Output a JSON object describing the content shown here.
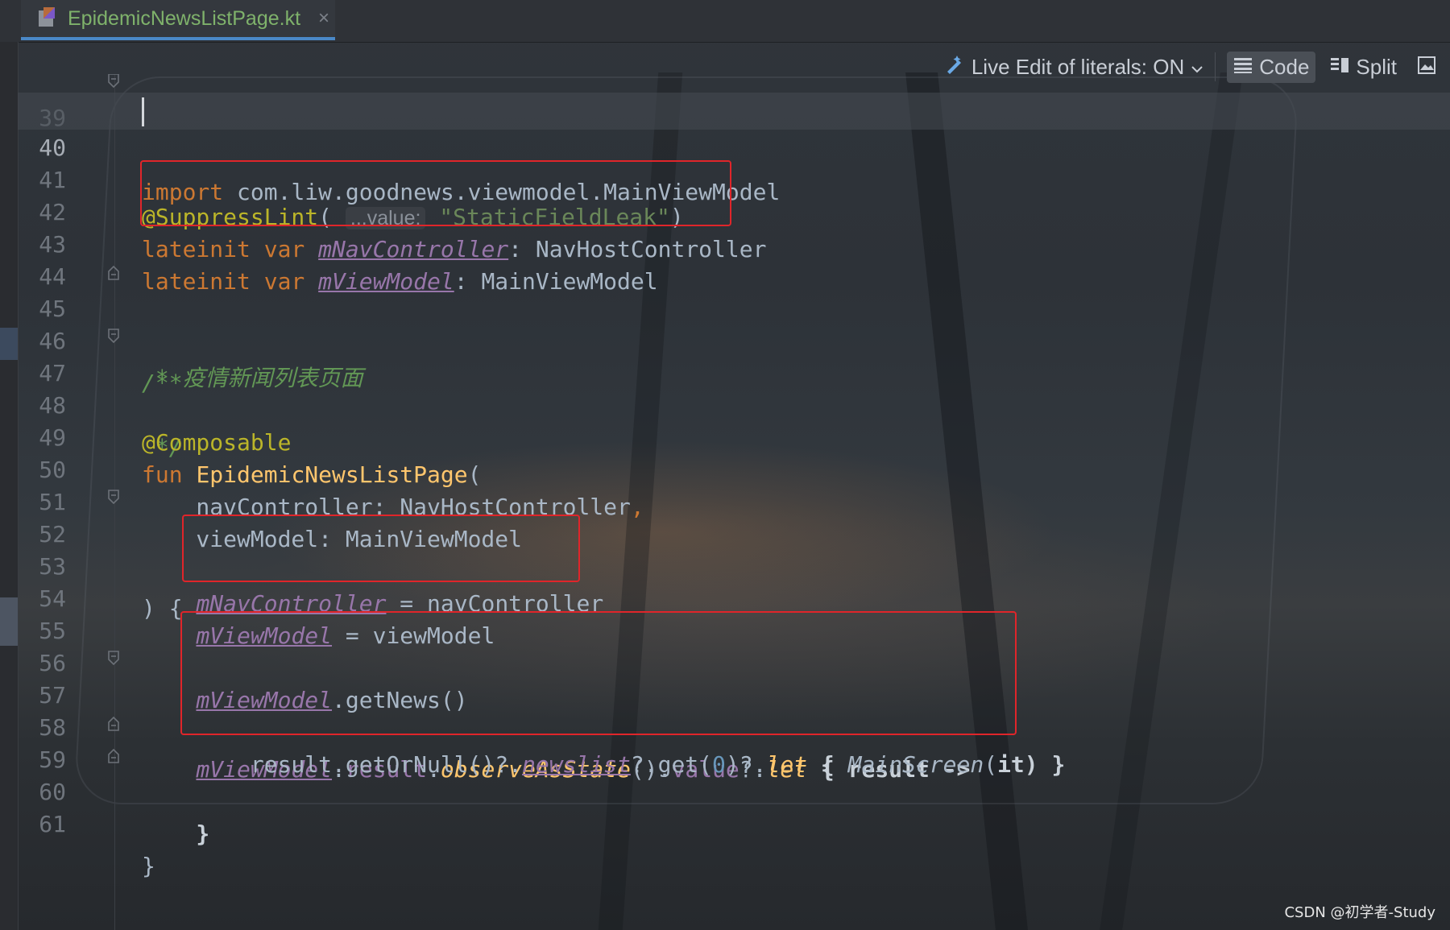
{
  "tab": {
    "filename": "EpidemicNewsListPage.kt",
    "close": "×"
  },
  "toolbar": {
    "live_edit": "Live Edit of literals: ON",
    "code": "Code",
    "split": "Split"
  },
  "code": {
    "l39": {
      "num": "39",
      "kw": "import",
      "rest": " com.liw.goodnews.viewmodel.MainViewModel"
    },
    "l40": {
      "num": "40"
    },
    "l41": {
      "num": "41",
      "ann": "@SuppressLint",
      "p1": "(",
      "hint": "...value:",
      "str": "\"StaticFieldLeak\"",
      "p2": ")"
    },
    "l42": {
      "num": "42",
      "kw": "lateinit var ",
      "prop": "mNavController",
      "rest": ": NavHostController"
    },
    "l43": {
      "num": "43",
      "kw": "lateinit var ",
      "prop": "mViewModel",
      "rest": ": MainViewModel"
    },
    "l44": {
      "num": "44"
    },
    "l45": {
      "num": "45",
      "cmt": "/**"
    },
    "l46": {
      "num": "46",
      "cmt": " * 疫情新闻列表页面"
    },
    "l47": {
      "num": "47",
      "cmt": " */"
    },
    "l48": {
      "num": "48",
      "ann": "@Composable"
    },
    "l49": {
      "num": "49",
      "kw": "fun ",
      "fn": "EpidemicNewsListPage",
      "rest": "("
    },
    "l50": {
      "num": "50",
      "text": "    navController: NavHostController",
      "comma": ","
    },
    "l51": {
      "num": "51",
      "text": "    viewModel: MainViewModel"
    },
    "l52": {
      "num": "52",
      "text": ") {"
    },
    "l53": {
      "num": "53",
      "indent": "    ",
      "prop": "mNavController",
      "rest": " = navController"
    },
    "l54": {
      "num": "54",
      "indent": "    ",
      "prop": "mViewModel",
      "rest": " = viewModel"
    },
    "l55": {
      "num": "55"
    },
    "l56": {
      "num": "56",
      "indent": "    ",
      "prop": "mViewModel",
      "rest": ".getNews()"
    },
    "l57": {
      "num": "57",
      "indent": "    ",
      "prop": "mViewModel",
      "a": ".",
      "b": "result",
      "c": ".",
      "d": "observeAsState",
      "e": "().",
      "f": "value",
      "g": "?.",
      "h": "let",
      "i": " { result ->"
    },
    "l58": {
      "num": "58",
      "indent": "        ",
      "a": "result.getOrNull()?.",
      "b": "newslist",
      "c": "?.get(",
      "d": "0",
      "e": ")?.",
      "f": "let",
      "g": " { ",
      "h": "MainScreen",
      "i": "(",
      "j": "it",
      "k": ") }"
    },
    "l59": {
      "num": "59",
      "text": "    }"
    },
    "l60": {
      "num": "60",
      "text": "}"
    },
    "l61": {
      "num": "61"
    }
  },
  "watermark": "CSDN @初学者-Study"
}
